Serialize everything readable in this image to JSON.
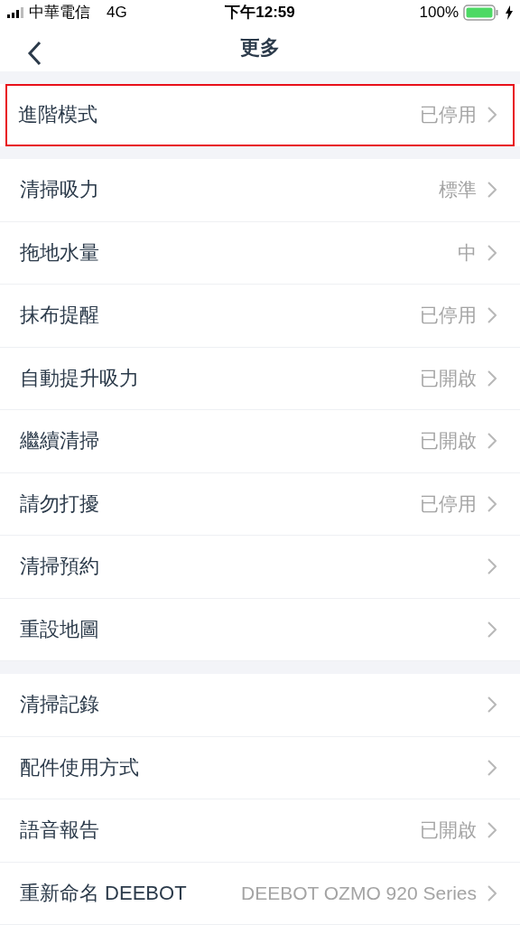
{
  "status_bar": {
    "carrier": "中華電信",
    "network": "4G",
    "time": "下午12:59",
    "battery": "100%"
  },
  "nav": {
    "title": "更多"
  },
  "sections": [
    {
      "items": [
        {
          "label": "進階模式",
          "value": "已停用",
          "highlighted": true
        }
      ]
    },
    {
      "items": [
        {
          "label": "清掃吸力",
          "value": "標準",
          "highlighted": false
        },
        {
          "label": "拖地水量",
          "value": "中",
          "highlighted": false
        },
        {
          "label": "抹布提醒",
          "value": "已停用",
          "highlighted": false
        },
        {
          "label": "自動提升吸力",
          "value": "已開啟",
          "highlighted": false
        },
        {
          "label": "繼續清掃",
          "value": "已開啟",
          "highlighted": false
        },
        {
          "label": "請勿打擾",
          "value": "已停用",
          "highlighted": false
        },
        {
          "label": "清掃預約",
          "highlighted": false
        },
        {
          "label": "重設地圖",
          "highlighted": false
        }
      ]
    },
    {
      "items": [
        {
          "label": "清掃記錄",
          "highlighted": false
        },
        {
          "label": "配件使用方式",
          "highlighted": false
        },
        {
          "label": "語音報告",
          "value": "已開啟",
          "highlighted": false
        },
        {
          "label": "重新命名 DEEBOT",
          "value": "DEEBOT OZMO 920 Series",
          "highlighted": false
        }
      ]
    }
  ]
}
